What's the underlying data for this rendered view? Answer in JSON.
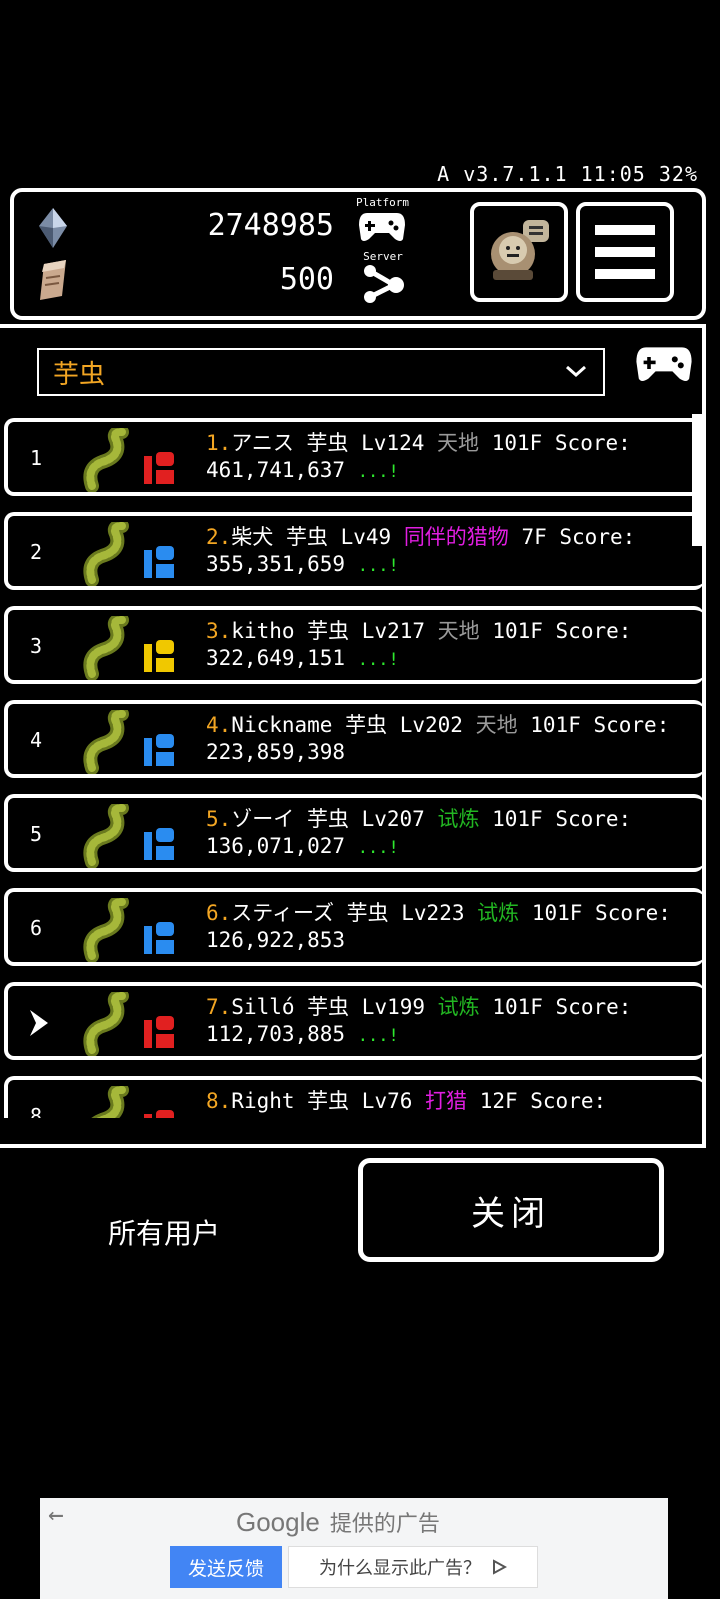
{
  "status_bar": {
    "text": "A v3.7.1.1 11:05 32%"
  },
  "resources": {
    "crystal_value": "2748985",
    "scroll_value": "500"
  },
  "platform": {
    "label": "Platform",
    "server_label": "Server"
  },
  "filter": {
    "selected": "芋虫"
  },
  "rankings": [
    {
      "rank": "1",
      "num": "1.",
      "name": "アニス 芋虫 Lv124",
      "stage": "天地",
      "stage_color": "#9a9a9a",
      "rest": "101F Score:",
      "score": "461,741,637",
      "dots": "...!",
      "cls_color": "#e12020"
    },
    {
      "rank": "2",
      "num": "2.",
      "name": "柴犬 芋虫 Lv49",
      "stage": "同伴的猎物",
      "stage_color": "#e11ee1",
      "rest": "7F Score:",
      "score": "355,351,659",
      "dots": "...!",
      "cls_color": "#2a8cf0"
    },
    {
      "rank": "3",
      "num": "3.",
      "name": "kitho 芋虫 Lv217",
      "stage": "天地",
      "stage_color": "#9a9a9a",
      "rest": "101F Score:",
      "score": "322,649,151",
      "dots": "...!",
      "cls_color": "#f0c800"
    },
    {
      "rank": "4",
      "num": "4.",
      "name": "Nickname 芋虫 Lv202",
      "stage": "天地",
      "stage_color": "#9a9a9a",
      "rest": "101F Score:",
      "score": "223,859,398",
      "dots": "",
      "cls_color": "#2a8cf0"
    },
    {
      "rank": "5",
      "num": "5.",
      "name": "ゾーイ 芋虫 Lv207",
      "stage": "试炼",
      "stage_color": "#22b622",
      "rest": "101F Score:",
      "score": "136,071,027",
      "dots": "...!",
      "cls_color": "#2a8cf0"
    },
    {
      "rank": "6",
      "num": "6.",
      "name": "スティーズ 芋虫 Lv223",
      "stage": "试炼",
      "stage_color": "#22b622",
      "rest": "101F",
      "score": "Score: 126,922,853",
      "dots": "",
      "cls_color": "#2a8cf0"
    },
    {
      "rank": "",
      "num": "7.",
      "name": "Silló 芋虫 Lv199",
      "stage": "试炼",
      "stage_color": "#22b622",
      "rest": "101F Score:",
      "score": "112,703,885",
      "dots": "...!",
      "cls_color": "#e12020"
    },
    {
      "rank": "8",
      "num": "8.",
      "name": "Right 芋虫 Lv76",
      "stage": "打猎",
      "stage_color": "#e11ee1",
      "rest": "12F Score:",
      "score": "",
      "dots": "",
      "cls_color": "#e12020"
    }
  ],
  "footer": {
    "all_users": "所有用户",
    "close": "关闭"
  },
  "ad": {
    "brand": "Google",
    "title_suffix": "提供的广告",
    "feedback": "发送反馈",
    "why": "为什么显示此广告？"
  }
}
